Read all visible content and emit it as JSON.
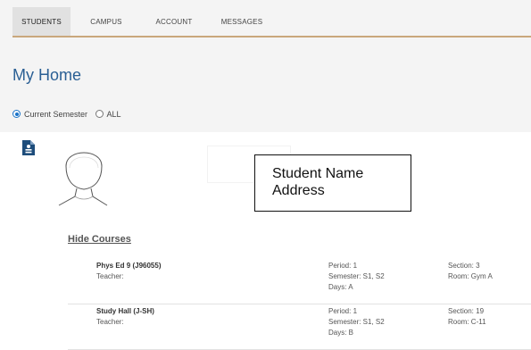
{
  "tabs": [
    {
      "label": "STUDENTS",
      "active": true
    },
    {
      "label": "CAMPUS",
      "active": false
    },
    {
      "label": "ACCOUNT",
      "active": false
    },
    {
      "label": "MESSAGES",
      "active": false
    }
  ],
  "page_title": "My Home",
  "filter": {
    "options": [
      {
        "label": "Current Semester",
        "selected": true
      },
      {
        "label": "ALL",
        "selected": false
      }
    ]
  },
  "student": {
    "name": "Student Name",
    "address": "Address",
    "icons": [
      "student-record-icon",
      "student-photo-placeholder"
    ]
  },
  "courses": {
    "toggle_label": "Hide Courses",
    "items": [
      {
        "name": "Phys Ed 9 (J96055)",
        "teacher": "Teacher:",
        "period": "Period: 1",
        "semester": "Semester: S1, S2",
        "days": "Days: A",
        "section": "Section: 3",
        "room": "Room: Gym A"
      },
      {
        "name": "Study Hall (J-SH)",
        "teacher": "Teacher:",
        "period": "Period: 1",
        "semester": "Semester: S1, S2",
        "days": "Days: B",
        "section": "Section: 19",
        "room": "Room: C-11"
      }
    ]
  },
  "colors": {
    "accent": "#c9a77c",
    "title": "#2a5f94",
    "radio": "#1a73c8",
    "band": "#f4f4f4"
  }
}
